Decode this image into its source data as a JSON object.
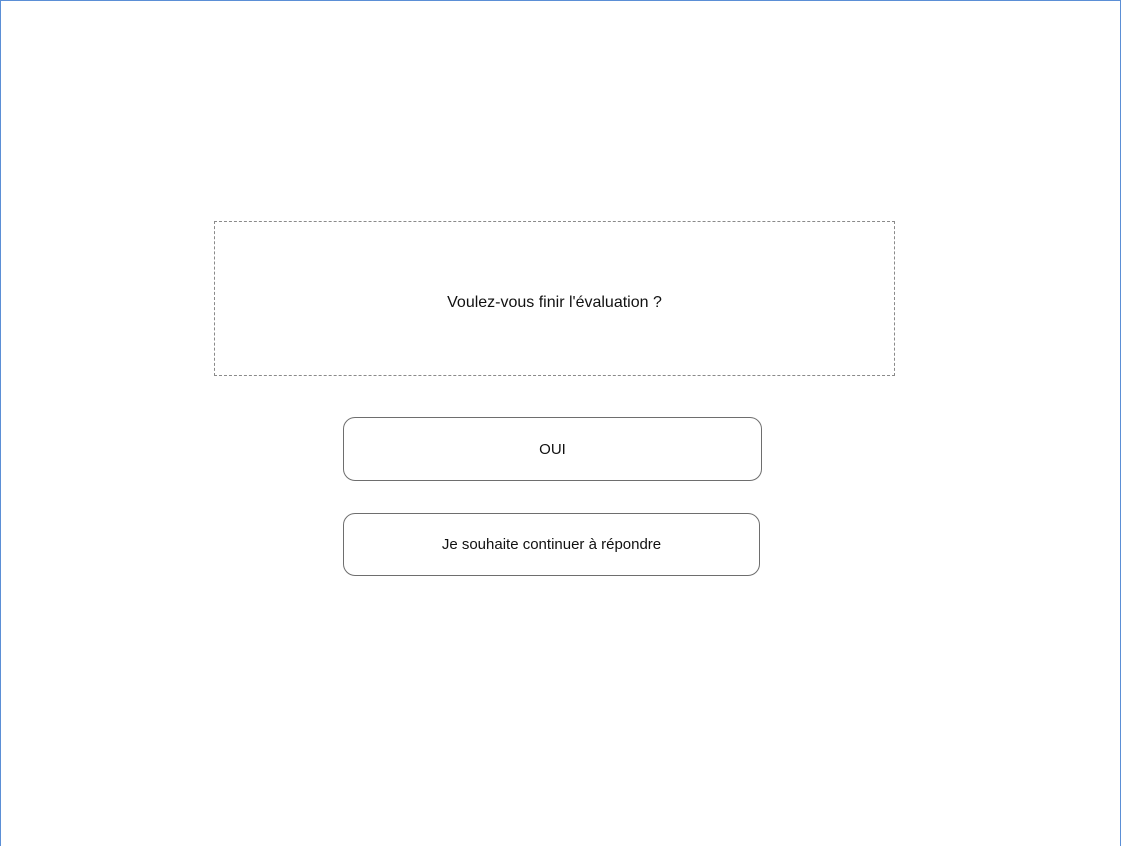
{
  "dialog": {
    "question": "Voulez-vous finir l'évaluation ?",
    "buttons": {
      "yes_label": "OUI",
      "continue_label": "Je souhaite continuer à répondre"
    }
  },
  "colors": {
    "frame_border": "#5b8fd6",
    "box_border": "#8a8a8a",
    "button_border": "#6e6e6e",
    "text": "#111111",
    "background": "#ffffff"
  }
}
